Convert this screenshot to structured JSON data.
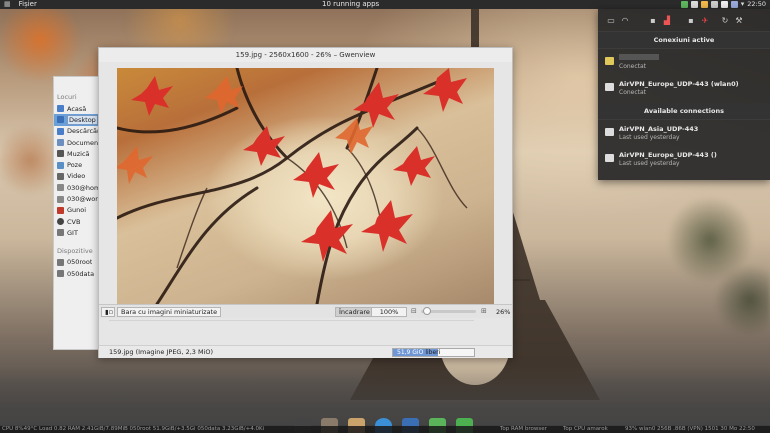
{
  "top_panel": {
    "menu": "Fișier",
    "center": "10 running apps",
    "clock": "22:50"
  },
  "places": {
    "section_places": "Locuri",
    "items": [
      {
        "label": "Acasă",
        "icon": "home-icon"
      },
      {
        "label": "Desktop",
        "icon": "desktop-icon"
      },
      {
        "label": "Descărcări",
        "icon": "downloads-icon"
      },
      {
        "label": "Documente",
        "icon": "documents-icon"
      },
      {
        "label": "Muzică",
        "icon": "music-icon"
      },
      {
        "label": "Poze",
        "icon": "pictures-icon"
      },
      {
        "label": "Video",
        "icon": "video-icon"
      },
      {
        "label": "030@home",
        "icon": "drive-icon"
      },
      {
        "label": "030@work",
        "icon": "drive-icon"
      },
      {
        "label": "Gunoi",
        "icon": "trash-icon"
      },
      {
        "label": "CVB",
        "icon": "network-icon"
      },
      {
        "label": "GIT",
        "icon": "network-icon"
      }
    ],
    "section_devices": "Dispozitive",
    "devices": [
      {
        "label": "050root",
        "icon": "drive-icon"
      },
      {
        "label": "050data",
        "icon": "drive-icon"
      }
    ]
  },
  "gwenview": {
    "title": "159.jpg - 2560x1600 - 26% – Gwenview",
    "thumb_bar_label": "Bara cu imagini miniaturizate",
    "fit_label": "Încadrare",
    "zoom_100": "100%",
    "zoom_current": "26%",
    "zoom_fraction": 0.1,
    "status": "159.jpg (Imagine JPEG, 2,3 MiO)",
    "space_value": "51,9 GiO",
    "space_suffix": "liberi",
    "space_fraction": 0.56
  },
  "network": {
    "active_header": "Conexiuni active",
    "active": [
      {
        "name": "",
        "status": "Conectat",
        "redacted": true
      },
      {
        "name": "AirVPN_Europe_UDP-443 (wlan0)",
        "status": "Conectat"
      }
    ],
    "available_header": "Available connections",
    "available": [
      {
        "name": "AirVPN_Asia_UDP-443",
        "status": "Last used yesterday"
      },
      {
        "name": "AirVPN_Europe_UDP-443 ()",
        "status": "Last used yesterday"
      }
    ]
  },
  "bottom_bar": {
    "left": "CPU 8%49°C Load 0.82 RAM 2.41GiB/7.89MiB 050root 51.9GiB/+3.5Gi 050data 3.23GiB/+4.0Ki",
    "mid": "Top RAM browser",
    "mid2": "Top CPU amarok",
    "right": "93% wlan0 256B .86B (VPN) 1501 30 Mo 22:50"
  },
  "colors": {
    "panel": "#2b2b2b",
    "selection": "#6a9fd8",
    "space_fill": "#6f97d6"
  }
}
